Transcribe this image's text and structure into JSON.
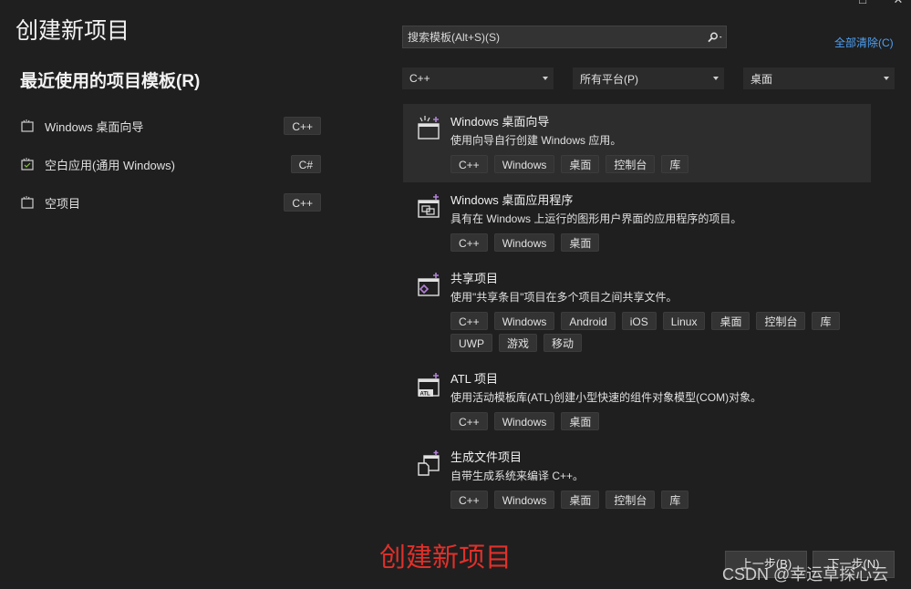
{
  "page_title": "创建新项目",
  "window_buttons": {
    "restore": "□",
    "close": "✕"
  },
  "recent": {
    "title": "最近使用的项目模板(R)",
    "items": [
      {
        "label": "Windows 桌面向导",
        "lang": "C++"
      },
      {
        "label": "空白应用(通用 Windows)",
        "lang": "C#"
      },
      {
        "label": "空项目",
        "lang": "C++"
      }
    ]
  },
  "search": {
    "value": "搜索模板(Alt+S)(S)"
  },
  "clear_all": "全部清除(C)",
  "filters": {
    "language": "C++",
    "platform": "所有平台(P)",
    "project_type": "桌面"
  },
  "templates": [
    {
      "name": "Windows 桌面向导",
      "desc": "使用向导自行创建 Windows 应用。",
      "tags": [
        [
          "C++",
          "Windows",
          "桌面",
          "控制台",
          "库"
        ]
      ]
    },
    {
      "name": "Windows 桌面应用程序",
      "desc": "具有在 Windows 上运行的图形用户界面的应用程序的项目。",
      "tags": [
        [
          "C++",
          "Windows",
          "桌面"
        ]
      ]
    },
    {
      "name": "共享项目",
      "desc": "使用\"共享条目\"项目在多个项目之间共享文件。",
      "tags": [
        [
          "C++",
          "Windows",
          "Android",
          "iOS",
          "Linux",
          "桌面",
          "控制台",
          "库"
        ],
        [
          "UWP",
          "游戏",
          "移动"
        ]
      ]
    },
    {
      "name": "ATL 项目",
      "desc": "使用活动模板库(ATL)创建小型快速的组件对象模型(COM)对象。",
      "tags": [
        [
          "C++",
          "Windows",
          "桌面"
        ]
      ]
    },
    {
      "name": "生成文件项目",
      "desc": "自带生成系统来编译 C++。",
      "tags": [
        [
          "C++",
          "Windows",
          "桌面",
          "控制台",
          "库"
        ]
      ]
    }
  ],
  "overlay_title": "创建新项目",
  "nav": {
    "back": "上一步(B)",
    "next": "下一步(N)"
  },
  "watermark": "CSDN @幸运草探心云",
  "colors": {
    "background": "#1f1f1f",
    "link": "#4ea1f3",
    "overlay_red": "#e0302a",
    "icon_purple": "#b180d7"
  }
}
